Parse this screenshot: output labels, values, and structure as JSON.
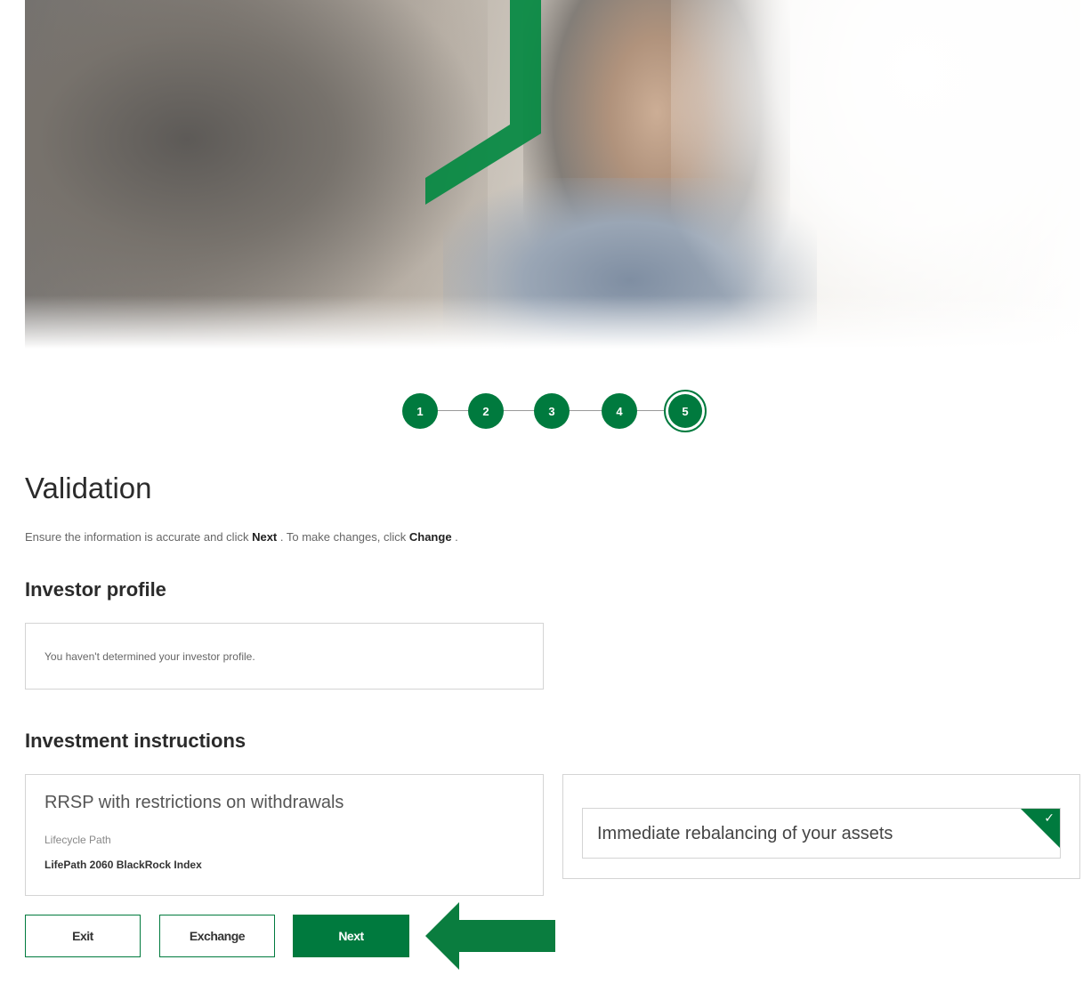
{
  "stepper": {
    "steps": [
      "1",
      "2",
      "3",
      "4",
      "5"
    ],
    "active_step": "5"
  },
  "page": {
    "title": "Validation",
    "instruction_prefix": "Ensure the information is accurate and click ",
    "instruction_next": "Next",
    "instruction_middle": " . To make changes, click ",
    "instruction_change": "Change",
    "instruction_suffix": " ."
  },
  "investor_profile": {
    "heading": "Investor profile",
    "message": "You haven't determined your investor profile."
  },
  "investment_instructions": {
    "heading": "Investment instructions",
    "plan_title": "RRSP with restrictions on withdrawals",
    "plan_type_label": "Lifecycle Path",
    "plan_fund": "LifePath 2060 BlackRock Index",
    "rebalancing_option": "Immediate rebalancing of your assets",
    "rebalancing_selected": true
  },
  "buttons": {
    "exit": "Exit",
    "exchange": "Exchange",
    "next": "Next"
  },
  "colors": {
    "brand_green": "#007a3e"
  }
}
